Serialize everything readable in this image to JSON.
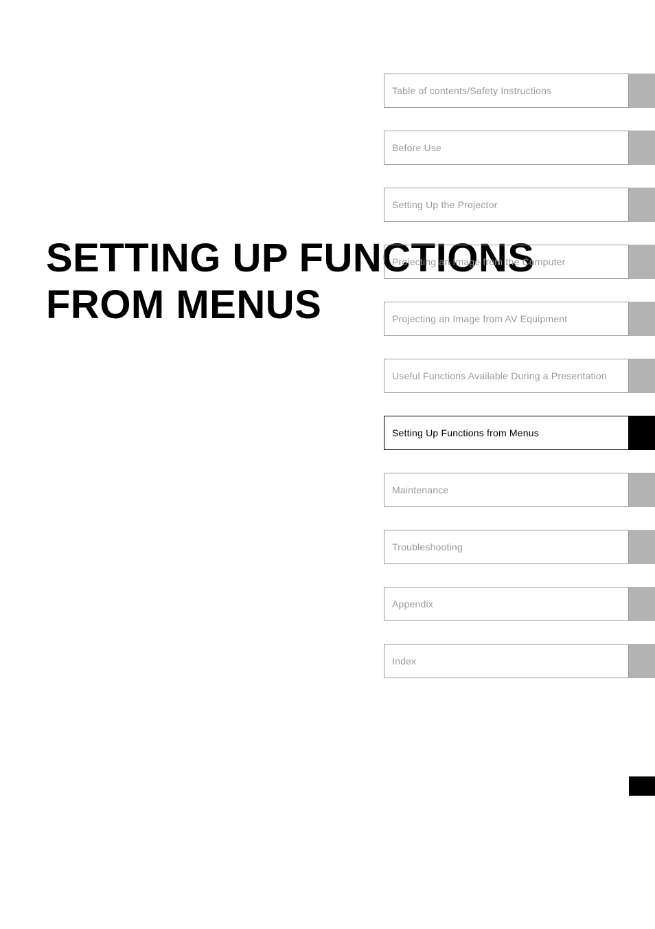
{
  "title": "SETTING UP FUNCTIONS FROM MENUS",
  "tabs": [
    {
      "label": "Table of contents/Safety Instructions",
      "active": false
    },
    {
      "label": "Before Use",
      "active": false
    },
    {
      "label": "Setting Up the Projector",
      "active": false
    },
    {
      "label": "Projecting an Image from the Computer",
      "active": false
    },
    {
      "label": "Projecting an Image from AV Equipment",
      "active": false
    },
    {
      "label": "Useful Functions Available During a Presentation",
      "active": false
    },
    {
      "label": "Setting Up Functions from Menus",
      "active": true
    },
    {
      "label": "Maintenance",
      "active": false
    },
    {
      "label": "Troubleshooting",
      "active": false
    },
    {
      "label": "Appendix",
      "active": false
    },
    {
      "label": "Index",
      "active": false
    }
  ]
}
